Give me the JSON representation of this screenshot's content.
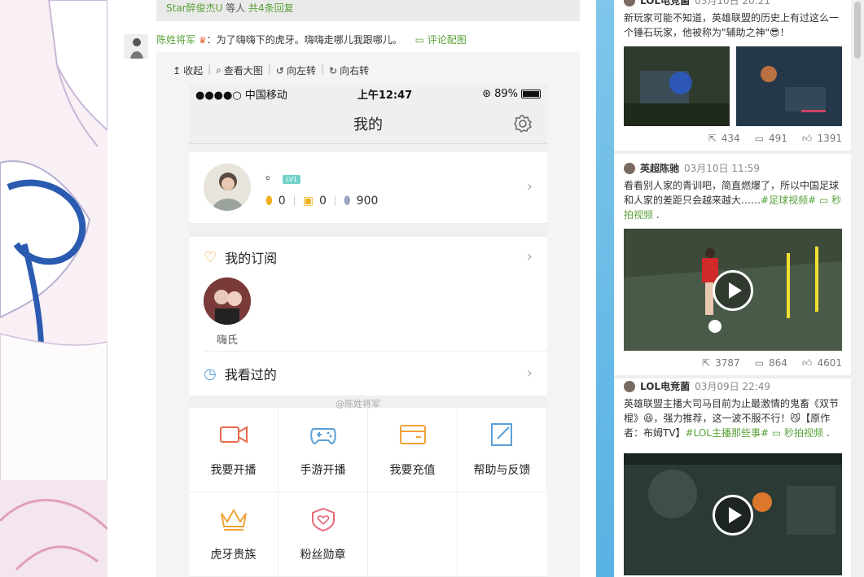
{
  "feed": {
    "reply_bar": {
      "users": "Star醉俊杰U",
      "mid": " 等人 ",
      "count": "共4条回复"
    },
    "comment": {
      "user": "陈姓将军",
      "text": "：为了嗨嗨下的虎牙。嗨嗨走哪儿我跟哪儿。",
      "pic_link": "评论配图"
    },
    "toolbar": {
      "collapse": "收起",
      "view_large": "查看大图",
      "rotate_left": "向左转",
      "rotate_right": "向右转"
    }
  },
  "phone": {
    "status": {
      "carrier": "●●●●○ 中国移动",
      "time": "上午12:47",
      "battery": "89%"
    },
    "title": "我的",
    "profile": {
      "name": "。",
      "level": "LV1",
      "stat1": "0",
      "stat2": "0",
      "stat3": "900"
    },
    "subscriptions": {
      "label": "我的订阅",
      "items": [
        {
          "name": "嗨氏"
        }
      ]
    },
    "history": {
      "label": "我看过的"
    },
    "watermark": "@陈姓将军",
    "grid": [
      {
        "label": "我要开播",
        "icon": "video-camera-icon"
      },
      {
        "label": "手游开播",
        "icon": "gamepad-icon"
      },
      {
        "label": "我要充值",
        "icon": "wallet-icon"
      },
      {
        "label": "帮助与反馈",
        "icon": "edit-icon"
      },
      {
        "label": "虎牙贵族",
        "icon": "crown-icon"
      },
      {
        "label": "粉丝勋章",
        "icon": "heart-shield-icon"
      }
    ]
  },
  "sidebar": {
    "posts": [
      {
        "user": "LOL电竞菌",
        "time": "03月10日 20:21",
        "text": "新玩家可能不知道，英雄联盟的历史上有过这么一个锤石玩家，他被称为\"辅助之神\"",
        "text_end": "！",
        "shares": "434",
        "comments": "491",
        "likes": "1391"
      },
      {
        "user": "英超陈驰",
        "time": "03月10日 11:59",
        "text": "看看别人家的青训吧，简直燃爆了，所以中国足球和人家的差距只会越来越大……",
        "tag": "#足球视频#",
        "link": "秒拍视频",
        "link_end": " .",
        "shares": "3787",
        "comments": "864",
        "likes": "4601"
      },
      {
        "user": "LOL电竞菌",
        "time": "03月09日 22:49",
        "text1": "英雄联盟主播大司马目前为止最激情的鬼畜《双节棍》",
        "text2": "，强力推荐，这一波不服不行！",
        "text3": "【原作者：布姆TV】",
        "tag": "#LOL主播那些事#",
        "link": "秒拍视频",
        "link_end": " ."
      }
    ]
  },
  "colors": {
    "accent_green": "#5aa13a",
    "sky": "#7ec6ea",
    "icon_orange": "#f0a33a"
  }
}
